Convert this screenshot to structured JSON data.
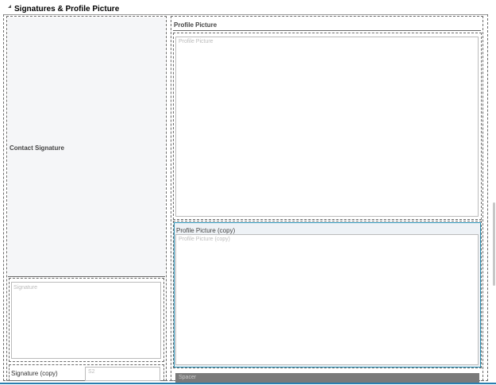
{
  "section": {
    "title": "Signatures & Profile Picture"
  },
  "left": {
    "contact_signature_label": "Contact Signature",
    "signature_placeholder": "Signature",
    "signature_copy_label": "Signature (copy)",
    "signature_copy_value": "S2"
  },
  "right": {
    "profile_picture_label": "Profile Picture",
    "profile_picture_placeholder": "Profile Picture",
    "profile_picture_copy_label": "Profile Picture (copy)",
    "profile_picture_copy_placeholder": "Profile Picture (copy)",
    "spacer_label": "Spacer"
  },
  "colors": {
    "accent_border": "#2a8fb3",
    "spacer_bar": "#7a7a7a"
  }
}
